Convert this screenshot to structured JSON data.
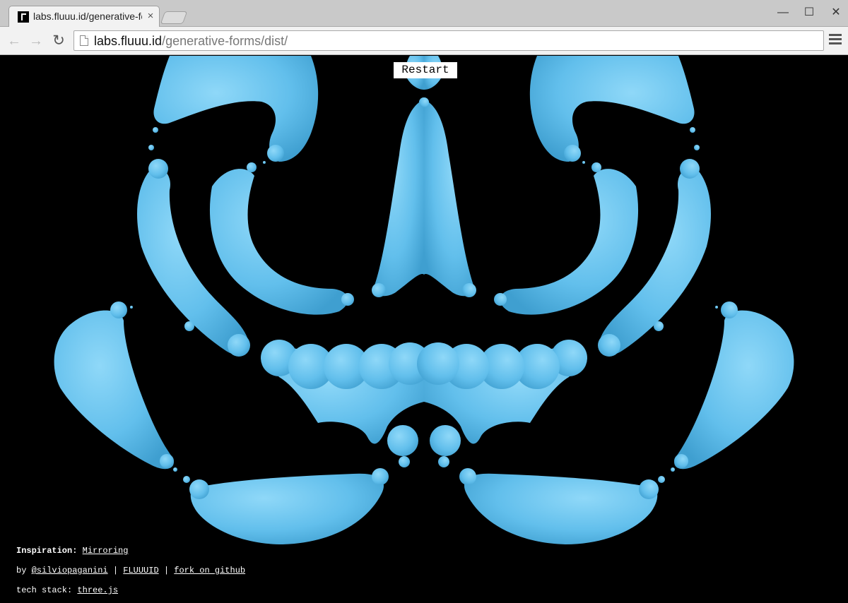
{
  "browser": {
    "tab_title": "labs.fluuu.id/generative-forms/dist/",
    "tab_close": "×",
    "url_host": "labs.fluuu.id",
    "url_path": "/generative-forms/dist/",
    "back_icon": "back-arrow-icon",
    "forward_icon": "forward-arrow-icon",
    "reload_icon": "reload-icon",
    "menu_icon": "hamburger-menu-icon",
    "window_controls": {
      "minimize": "—",
      "maximize": "☐",
      "close": "✕"
    }
  },
  "page": {
    "restart_label": "Restart",
    "background": "#000000",
    "shape_color": "#6cc6ef",
    "inspiration_label": "Inspiration:",
    "inspiration_link": "Mirroring",
    "by_prefix": "by",
    "author_link": "@silviopaganini",
    "separator": "|",
    "studio_link": "FLUUUID",
    "fork_link": "fork on github",
    "stack_label": "tech stack:",
    "stack_link": "three.js"
  }
}
